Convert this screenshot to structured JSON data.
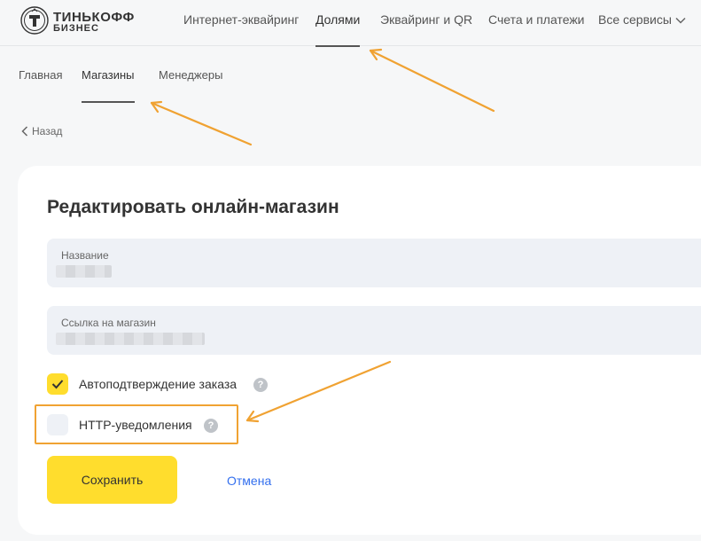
{
  "brand": {
    "line1": "ТИНЬКОФФ",
    "line2": "БИЗНЕС"
  },
  "top_nav": {
    "items": [
      {
        "label": "Интернет-эквайринг"
      },
      {
        "label": "Долями"
      },
      {
        "label": "Эквайринг и QR"
      },
      {
        "label": "Счета и платежи"
      },
      {
        "label": "Все сервисы"
      }
    ],
    "active": "Долями"
  },
  "sub_nav": {
    "items": [
      {
        "label": "Главная"
      },
      {
        "label": "Магазины"
      },
      {
        "label": "Менеджеры"
      }
    ],
    "active": "Магазины"
  },
  "back": {
    "label": "Назад"
  },
  "form": {
    "title": "Редактировать онлайн-магазин",
    "name_field": {
      "label": "Название",
      "value": ""
    },
    "link_field": {
      "label": "Ссылка на магазин",
      "value": ""
    },
    "auto_confirm": {
      "label": "Автоподтверждение заказа",
      "checked": true
    },
    "http_notify": {
      "label": "HTTP-уведомления",
      "checked": false
    },
    "help_glyph": "?",
    "save_label": "Сохранить",
    "cancel_label": "Отмена"
  },
  "colors": {
    "accent_yellow": "#ffdd2d",
    "link_blue": "#336fee",
    "annotation_orange": "#f0a232"
  },
  "icons": {
    "logo": "tinkoff-shield-icon",
    "chevron": "chevron-down-icon",
    "back": "chevron-left-icon",
    "check": "check-icon",
    "help": "help-icon"
  }
}
